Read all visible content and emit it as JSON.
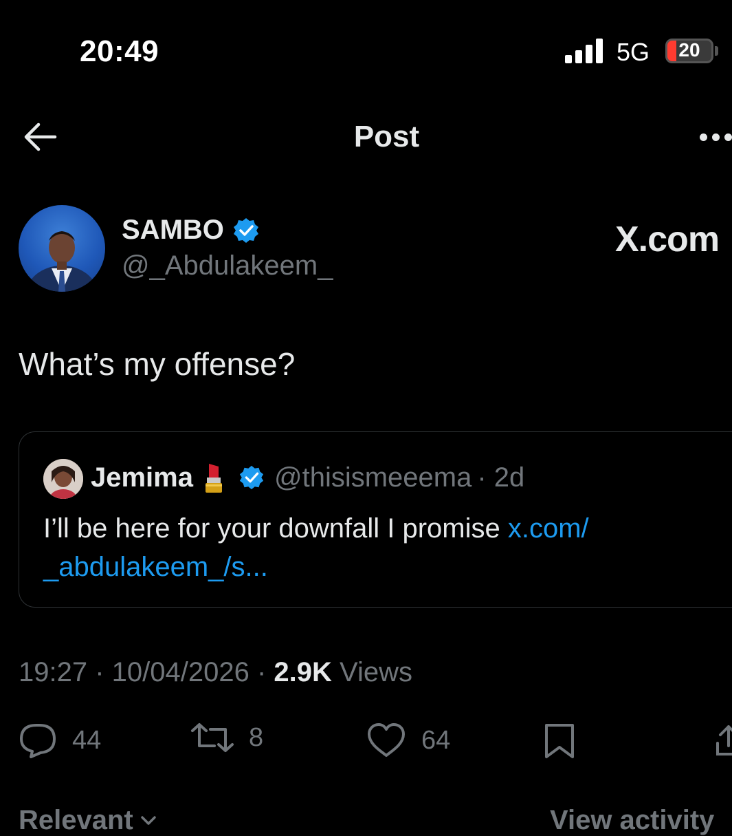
{
  "status_bar": {
    "time": "20:49",
    "network": "5G",
    "battery": "20",
    "battery_level_percent": 20
  },
  "header": {
    "title": "Post",
    "back_icon": "arrow-left-icon",
    "more_icon": "more-horizontal-icon"
  },
  "author": {
    "name": "SAMBO",
    "handle": "@_Abdulakeem_",
    "verified": true,
    "watermark": "X.com"
  },
  "post": {
    "text": "What’s my offense?"
  },
  "quote": {
    "name": "Jemima",
    "emoji": "lipstick",
    "handle": "@thisismeeema",
    "age": "· 2d",
    "text": "I’ll be here for your downfall I promise ",
    "link_line1": "x.com/",
    "link_line2": "_abdulakeem_/s..."
  },
  "meta": {
    "timestamp": "19:27 · 10/04/2026 · ",
    "views_count": "2.9K",
    "views_label": " Views"
  },
  "actions": {
    "replies": "44",
    "reposts": "8",
    "likes": "64"
  },
  "bottom": {
    "sort_label": "Relevant",
    "activity_label": "View activity"
  },
  "colors": {
    "background": "#000000",
    "text": "#e7e9ea",
    "secondary": "#71767b",
    "accent": "#1d9bf0",
    "border": "#2f3336",
    "battery_low": "#ff3b30"
  }
}
